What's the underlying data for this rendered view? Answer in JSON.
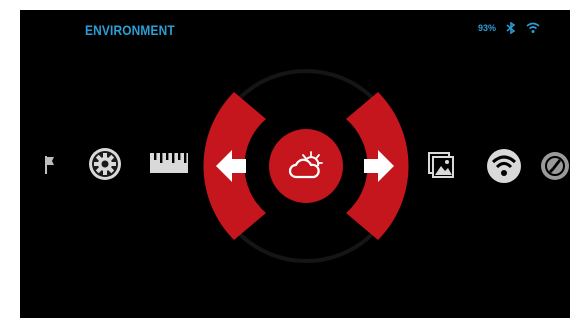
{
  "header": {
    "title": "ENVIRONMENT",
    "battery_text": "93%",
    "bluetooth_icon": "bluetooth-icon",
    "wifi_icon": "wifi-icon"
  },
  "menu": {
    "selected": "environment",
    "items": [
      {
        "id": "flag",
        "icon": "flag-icon"
      },
      {
        "id": "settings",
        "icon": "gear-icon"
      },
      {
        "id": "ruler",
        "icon": "ruler-icon"
      },
      {
        "id": "environment",
        "icon": "weather-icon"
      },
      {
        "id": "gallery",
        "icon": "gallery-icon"
      },
      {
        "id": "wifi",
        "icon": "wifi-icon"
      },
      {
        "id": "compass",
        "icon": "compass-icon"
      }
    ],
    "nav_left_icon": "arrow-left-icon",
    "nav_right_icon": "arrow-right-icon"
  },
  "colors": {
    "accent": "#2a9fd6",
    "selector": "#c4161c",
    "icon": "#d9d9d9",
    "background": "#000000"
  }
}
